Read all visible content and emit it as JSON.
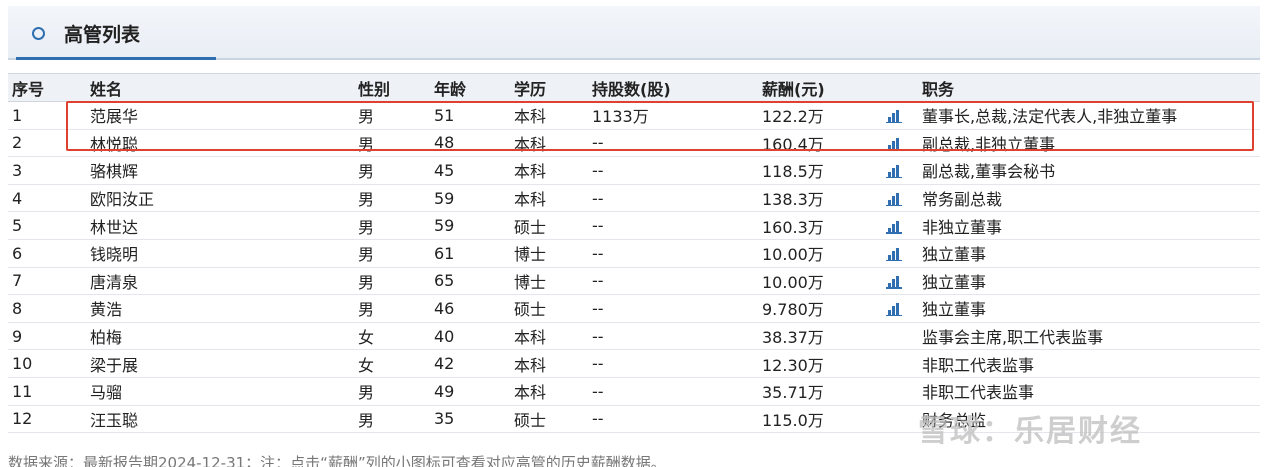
{
  "panel": {
    "title": "高管列表"
  },
  "columns": [
    "序号",
    "姓名",
    "性别",
    "年龄",
    "学历",
    "持股数(股)",
    "薪酬(元)",
    "",
    "职务"
  ],
  "rows": [
    {
      "no": "1",
      "name": "范展华",
      "gender": "男",
      "age": "51",
      "edu": "本科",
      "shares": "1133万",
      "salary": "122.2万",
      "chart": true,
      "title": "董事长,总裁,法定代表人,非独立董事"
    },
    {
      "no": "2",
      "name": "林悦聪",
      "gender": "男",
      "age": "48",
      "edu": "本科",
      "shares": "--",
      "salary": "160.4万",
      "chart": true,
      "title": "副总裁,非独立董事"
    },
    {
      "no": "3",
      "name": "骆棋辉",
      "gender": "男",
      "age": "45",
      "edu": "本科",
      "shares": "--",
      "salary": "118.5万",
      "chart": true,
      "title": "副总裁,董事会秘书"
    },
    {
      "no": "4",
      "name": "欧阳汝正",
      "gender": "男",
      "age": "59",
      "edu": "本科",
      "shares": "--",
      "salary": "138.3万",
      "chart": true,
      "title": "常务副总裁"
    },
    {
      "no": "5",
      "name": "林世达",
      "gender": "男",
      "age": "59",
      "edu": "硕士",
      "shares": "--",
      "salary": "160.3万",
      "chart": true,
      "title": "非独立董事"
    },
    {
      "no": "6",
      "name": "钱晓明",
      "gender": "男",
      "age": "61",
      "edu": "博士",
      "shares": "--",
      "salary": "10.00万",
      "chart": true,
      "title": "独立董事"
    },
    {
      "no": "7",
      "name": "唐清泉",
      "gender": "男",
      "age": "65",
      "edu": "博士",
      "shares": "--",
      "salary": "10.00万",
      "chart": true,
      "title": "独立董事"
    },
    {
      "no": "8",
      "name": "黄浩",
      "gender": "男",
      "age": "46",
      "edu": "硕士",
      "shares": "--",
      "salary": "9.780万",
      "chart": true,
      "title": "独立董事"
    },
    {
      "no": "9",
      "name": "柏梅",
      "gender": "女",
      "age": "40",
      "edu": "本科",
      "shares": "--",
      "salary": "38.37万",
      "chart": false,
      "title": "监事会主席,职工代表监事"
    },
    {
      "no": "10",
      "name": "梁于展",
      "gender": "女",
      "age": "42",
      "edu": "本科",
      "shares": "--",
      "salary": "12.30万",
      "chart": false,
      "title": "非职工代表监事"
    },
    {
      "no": "11",
      "name": "马骝",
      "gender": "男",
      "age": "49",
      "edu": "本科",
      "shares": "--",
      "salary": "35.71万",
      "chart": false,
      "title": "非职工代表监事"
    },
    {
      "no": "12",
      "name": "汪玉聪",
      "gender": "男",
      "age": "35",
      "edu": "硕士",
      "shares": "--",
      "salary": "115.0万",
      "chart": false,
      "title": "财务总监"
    }
  ],
  "footnote": "数据来源：最新报告期2024-12-31；注：点击“薪酬”列的小图标可查看对应高管的历史薪酬数据。",
  "watermark": "雪球：乐居财经",
  "colors": {
    "accent": "#2f6fb1",
    "highlight": "#e0402f",
    "header_bg": "#eef1f5"
  }
}
